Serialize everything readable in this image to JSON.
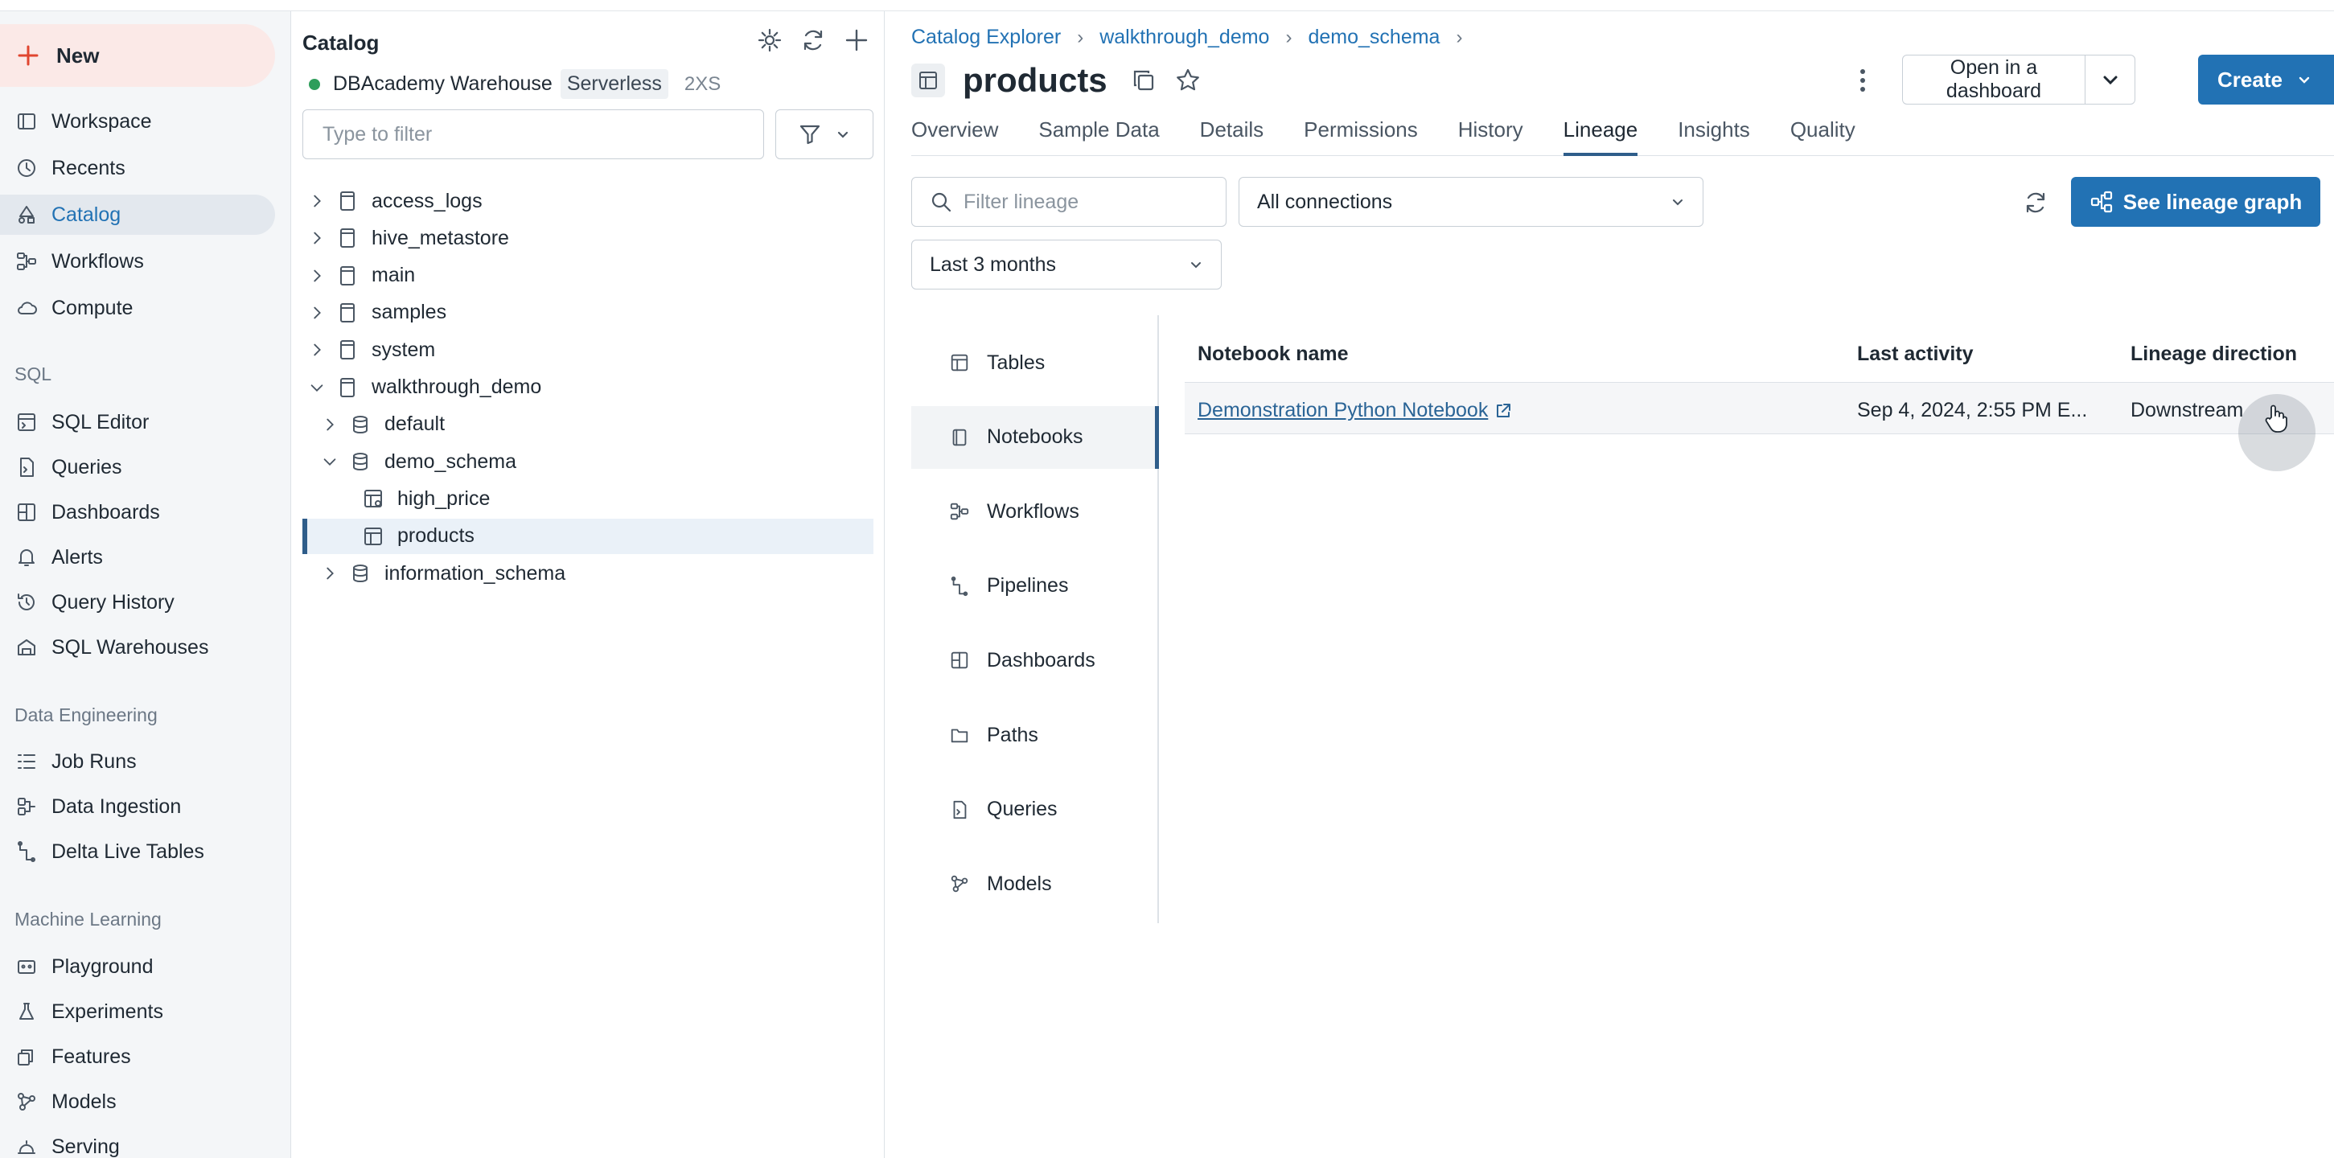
{
  "nav": {
    "new_label": "New",
    "items_top": [
      {
        "label": "Workspace",
        "icon": "workspace-icon"
      },
      {
        "label": "Recents",
        "icon": "clock-icon"
      },
      {
        "label": "Catalog",
        "icon": "catalog-icon",
        "active": true
      },
      {
        "label": "Workflows",
        "icon": "workflows-icon"
      },
      {
        "label": "Compute",
        "icon": "cloud-icon"
      }
    ],
    "sql_section": "SQL",
    "items_sql": [
      {
        "label": "SQL Editor",
        "icon": "sql-editor-icon"
      },
      {
        "label": "Queries",
        "icon": "queries-icon"
      },
      {
        "label": "Dashboards",
        "icon": "dashboards-icon"
      },
      {
        "label": "Alerts",
        "icon": "bell-icon"
      },
      {
        "label": "Query History",
        "icon": "history-icon"
      },
      {
        "label": "SQL Warehouses",
        "icon": "warehouse-icon"
      }
    ],
    "de_section": "Data Engineering",
    "items_de": [
      {
        "label": "Job Runs",
        "icon": "job-runs-icon"
      },
      {
        "label": "Data Ingestion",
        "icon": "ingestion-icon"
      },
      {
        "label": "Delta Live Tables",
        "icon": "pipeline-icon"
      }
    ],
    "ml_section": "Machine Learning",
    "items_ml": [
      {
        "label": "Playground",
        "icon": "playground-icon"
      },
      {
        "label": "Experiments",
        "icon": "flask-icon"
      },
      {
        "label": "Features",
        "icon": "features-icon"
      },
      {
        "label": "Models",
        "icon": "models-icon"
      },
      {
        "label": "Serving",
        "icon": "serving-icon"
      }
    ]
  },
  "catalog": {
    "title": "Catalog",
    "warehouse_name": "DBAcademy Warehouse",
    "warehouse_badge": "Serverless",
    "warehouse_size": "2XS",
    "filter_placeholder": "Type to filter",
    "tree": [
      {
        "label": "access_logs",
        "level": 0,
        "kind": "catalog",
        "expanded": false
      },
      {
        "label": "hive_metastore",
        "level": 0,
        "kind": "catalog",
        "expanded": false
      },
      {
        "label": "main",
        "level": 0,
        "kind": "catalog",
        "expanded": false
      },
      {
        "label": "samples",
        "level": 0,
        "kind": "catalog",
        "expanded": false
      },
      {
        "label": "system",
        "level": 0,
        "kind": "catalog",
        "expanded": false
      },
      {
        "label": "walkthrough_demo",
        "level": 0,
        "kind": "catalog",
        "expanded": true
      },
      {
        "label": "default",
        "level": 1,
        "kind": "schema",
        "expanded": false
      },
      {
        "label": "demo_schema",
        "level": 1,
        "kind": "schema",
        "expanded": true
      },
      {
        "label": "high_price",
        "level": 2,
        "kind": "view"
      },
      {
        "label": "products",
        "level": 2,
        "kind": "table",
        "selected": true
      },
      {
        "label": "information_schema",
        "level": 1,
        "kind": "schema",
        "expanded": false
      }
    ]
  },
  "main": {
    "breadcrumb": [
      "Catalog Explorer",
      "walkthrough_demo",
      "demo_schema"
    ],
    "title": "products",
    "open_dashboard_label": "Open in a dashboard",
    "create_label": "Create",
    "tabs": [
      "Overview",
      "Sample Data",
      "Details",
      "Permissions",
      "History",
      "Lineage",
      "Insights",
      "Quality"
    ],
    "active_tab": "Lineage",
    "lineage": {
      "filter_placeholder": "Filter lineage",
      "connections_value": "All connections",
      "time_value": "Last 3 months",
      "graph_button": "See lineage graph",
      "types": [
        {
          "label": "Tables",
          "icon": "table-icon"
        },
        {
          "label": "Notebooks",
          "icon": "notebook-icon",
          "active": true
        },
        {
          "label": "Workflows",
          "icon": "workflows-icon"
        },
        {
          "label": "Pipelines",
          "icon": "pipeline-icon"
        },
        {
          "label": "Dashboards",
          "icon": "dashboards-icon"
        },
        {
          "label": "Paths",
          "icon": "folder-icon"
        },
        {
          "label": "Queries",
          "icon": "queries-icon"
        },
        {
          "label": "Models",
          "icon": "models-icon"
        }
      ],
      "columns": [
        "Notebook name",
        "Last activity",
        "Lineage direction"
      ],
      "rows": [
        {
          "name": "Demonstration Python Notebook",
          "last_activity": "Sep 4, 2024, 2:55 PM E...",
          "direction": "Downstream"
        }
      ]
    }
  },
  "colors": {
    "accent": "#2272b4",
    "new_button_bg": "#fbe9e7",
    "status_green": "#2e9e5b"
  }
}
